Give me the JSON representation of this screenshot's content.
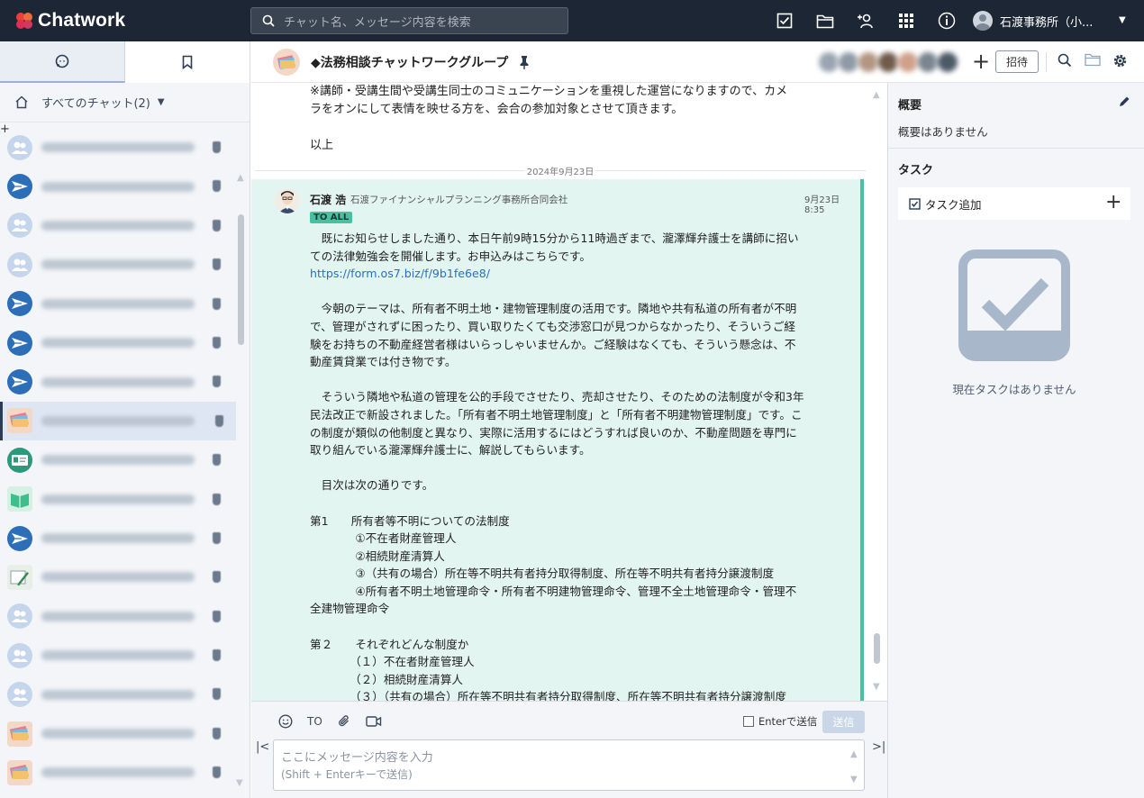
{
  "app": {
    "name": "Chatwork"
  },
  "search": {
    "placeholder": "チャット名、メッセージ内容を検索"
  },
  "top_icons": [
    "task-check-icon",
    "folder-icon",
    "add-contact-icon",
    "apps-grid-icon",
    "info-icon"
  ],
  "user": {
    "name": "石渡事務所（小..."
  },
  "sidebar": {
    "filter_label": "すべてのチャット(2)",
    "rooms": [
      {
        "icon": "people",
        "active": false
      },
      {
        "icon": "plane",
        "active": false
      },
      {
        "icon": "people",
        "active": false
      },
      {
        "icon": "people",
        "active": false
      },
      {
        "icon": "plane",
        "active": false
      },
      {
        "icon": "plane",
        "active": false
      },
      {
        "icon": "plane",
        "active": false
      },
      {
        "icon": "book",
        "active": true
      },
      {
        "icon": "card",
        "active": false
      },
      {
        "icon": "green",
        "active": false
      },
      {
        "icon": "plane",
        "active": false
      },
      {
        "icon": "pen",
        "active": false
      },
      {
        "icon": "people",
        "active": false
      },
      {
        "icon": "people",
        "active": false
      },
      {
        "icon": "people",
        "active": false
      },
      {
        "icon": "book",
        "active": false
      },
      {
        "icon": "book",
        "active": false
      }
    ]
  },
  "chat": {
    "title": "◆法務相談チャットワークグループ",
    "invite_label": "招待",
    "prev_text": "※講師・受講生間や受講生同士のコミュニケーションを重視した運営になりますので、カメラをオンにして表情を映せる方を、会合の参加対象とさせて頂きます。",
    "prev_end": "以上",
    "date": "2024年9月23日",
    "message": {
      "sender": "石渡 浩",
      "org": "石渡ファイナンシャルプランニング事務所合同会社",
      "time": "9月23日 8:35",
      "to_label": "TO ALL",
      "p1": "　既にお知らせしました通り、本日午前9時15分から11時過ぎまで、瀧澤輝弁護士を講師に招いての法律勉強会を開催します。お申込みはこちらです。",
      "link": "https://form.os7.biz/f/9b1fe6e8/",
      "p2": "　今朝のテーマは、所有者不明土地・建物管理制度の活用です。隣地や共有私道の所有者が不明で、管理がされずに困ったり、買い取りたくても交渉窓口が見つからなかったり、そういうご経験をお持ちの不動産経営者様はいらっしゃいませんか。ご経験はなくても、そういう懸念は、不動産賃貸業では付き物です。",
      "p3": "　そういう隣地や私道の管理を公的手段でさせたり、売却させたり、そのための法制度が令和3年民法改正で新設されました。「所有者不明土地管理制度」と「所有者不明建物管理制度」です。この制度が類似の他制度と異なり、実際に活用するにはどうすれば良いのか、不動産問題を専門に取り組んでいる瀧澤輝弁護士に、解説してもらいます。",
      "p4": "　目次は次の通りです。",
      "p5": "第1　　所有者等不明についての法制度\n　　　　①不在者財産管理人\n　　　　②相続財産清算人\n　　　　③（共有の場合）所在等不明共有者持分取得制度、所在等不明共有者持分譲渡制度\n　　　　④所有者不明土地管理命令・所有者不明建物管理命令、管理不全土地管理命令・管理不全建物管理命令",
      "p6": "第２　　それぞれどんな制度か\n　　　　（１）不在者財産管理人\n　　　　（２）相続財産清算人\n　　　　（３）（共有の場合）所在等不明共有者持分取得制度、所在等不明共有者持分譲渡制度"
    }
  },
  "composer": {
    "to_label": "TO",
    "enter_send_label": "Enterで送信",
    "send_label": "送信",
    "placeholder_line1": "ここにメッセージ内容を入力",
    "placeholder_line2": "(Shift + Enterキーで送信)"
  },
  "right_panel": {
    "overview_title": "概要",
    "overview_text": "概要はありません",
    "task_title": "タスク",
    "task_add_label": "タスク追加",
    "no_task_text": "現在タスクはありません"
  },
  "colors": {
    "topbar": "#1d2634",
    "accent_green": "#4bc0a0",
    "message_bg": "#e3f5f0",
    "link": "#2a6fc4",
    "brand_red": "#e8413c"
  }
}
